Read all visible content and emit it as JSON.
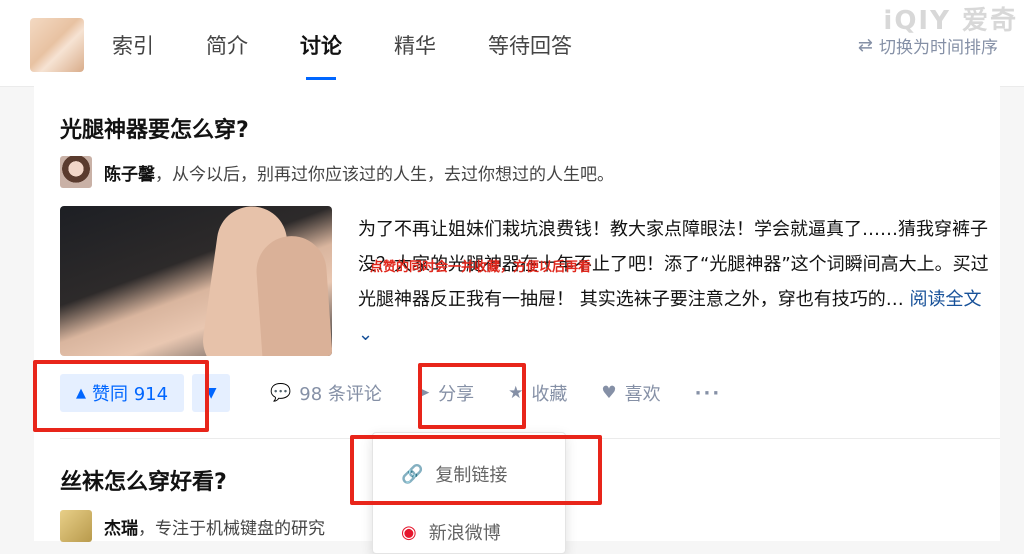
{
  "nav": {
    "tabs": [
      {
        "label": "索引"
      },
      {
        "label": "简介"
      },
      {
        "label": "讨论"
      },
      {
        "label": "精华"
      },
      {
        "label": "等待回答"
      }
    ],
    "active_tab": "讨论",
    "sort_label": "切换为时间排序",
    "watermark": "iQIY 爱奇"
  },
  "answer1": {
    "question": "光腿神器要怎么穿?",
    "author_name": "陈子馨",
    "author_bio": "，从今以后，别再过你应该过的人生，去过你想过的人生吧。",
    "excerpt": "为了不再让姐妹们栽坑浪费钱！教大家点障眼法！学会就逼真了……猜我穿裤子没？大家的光腿神器在十年不止了吧！添了“光腿神器”这个词瞬间高大上。买过光腿神器反正我有一抽屉！ 其实选袜子要注意之外，穿也有技巧的…",
    "overlay_note": "点赞的同时会一并收藏，方便以后再看",
    "read_more": "阅读全文",
    "vote_label": "赞同 914",
    "comments_label": "98 条评论",
    "share_label": "分享",
    "favorite_label": "收藏",
    "like_label": "喜欢",
    "more_label": "···"
  },
  "answer2": {
    "question": "丝袜怎么穿好看?",
    "author_name": "杰瑞",
    "author_bio": "，专注于机械键盘的研究"
  },
  "share_menu": {
    "copy_link": "复制链接",
    "weibo": "新浪微博"
  },
  "colors": {
    "accent": "#0066ff",
    "highlight_box": "#e8251a",
    "link": "#175199"
  }
}
